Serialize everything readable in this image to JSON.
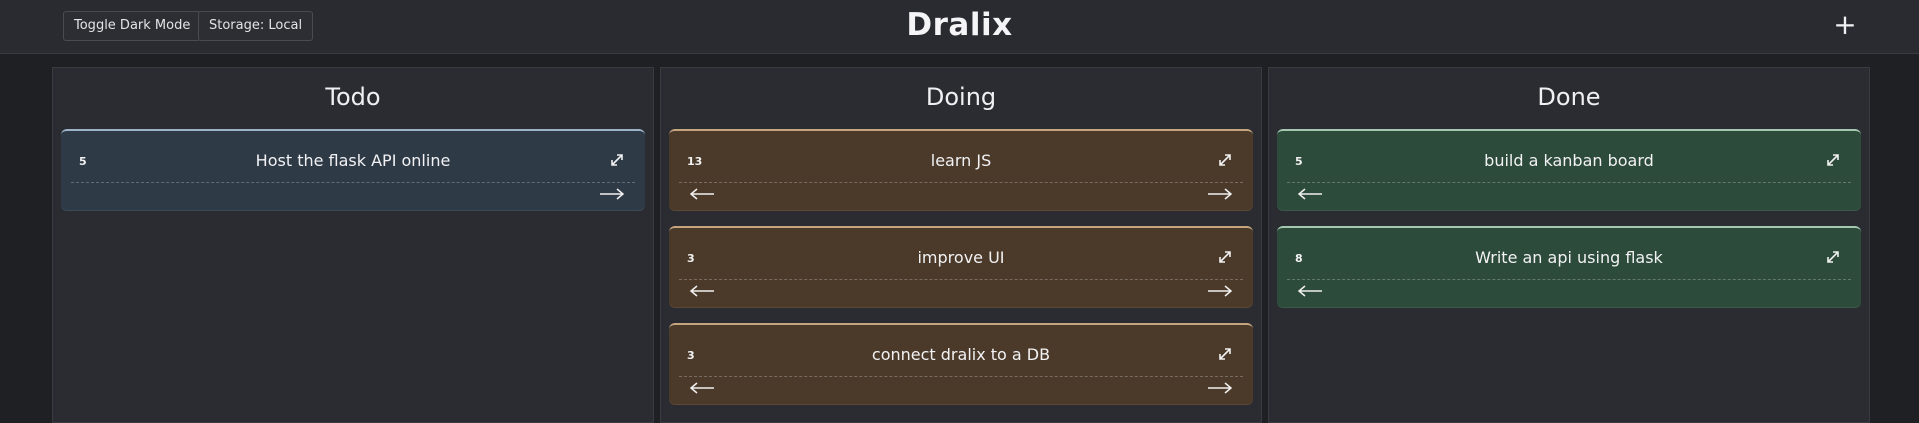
{
  "header": {
    "toggle_label": "Toggle Dark Mode",
    "storage_label": "Storage: Local",
    "title": "Dralix",
    "add_label": "+"
  },
  "columns": [
    {
      "title": "Todo",
      "cards": [
        {
          "points": "5",
          "title": "Host the flask API online"
        }
      ]
    },
    {
      "title": "Doing",
      "cards": [
        {
          "points": "13",
          "title": "learn JS"
        },
        {
          "points": "3",
          "title": "improve UI"
        },
        {
          "points": "3",
          "title": "connect dralix to a DB"
        }
      ]
    },
    {
      "title": "Done",
      "cards": [
        {
          "points": "5",
          "title": "build a kanban board"
        },
        {
          "points": "8",
          "title": "Write an api using flask"
        }
      ]
    }
  ],
  "colors": {
    "todo_card": "#2f3a47",
    "doing_card": "#4b3a2a",
    "done_card": "#2d4b3b",
    "background": "#1f2024"
  },
  "icons": {
    "expand": "expand-icon",
    "move_left": "arrow-left-icon",
    "move_right": "arrow-right-icon",
    "add": "plus-icon"
  }
}
